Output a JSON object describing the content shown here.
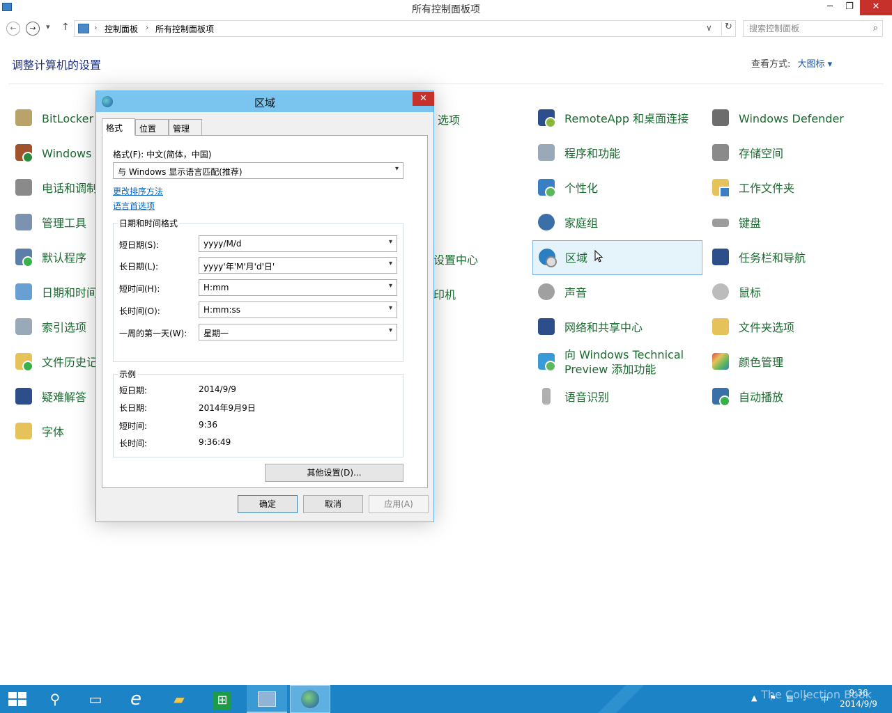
{
  "window": {
    "title": "所有控制面板项",
    "min": "─",
    "max": "❐",
    "close": "✕"
  },
  "nav": {
    "back": "←",
    "forward": "→",
    "recent": "▾",
    "up": "↑",
    "breadcrumbs": [
      "控制面板",
      "所有控制面板项"
    ],
    "separator": "›",
    "dropdown": "∨",
    "refresh": "↻",
    "search_placeholder": "搜索控制面板",
    "search_icon": "⌕"
  },
  "header": {
    "heading": "调整计算机的设置",
    "view_by_label": "查看方式:",
    "view_by_value": "大图标 ▾"
  },
  "items": {
    "col1": [
      "BitLocker",
      "Windows",
      "电话和调制",
      "管理工具",
      "默认程序",
      "日期和时间",
      "索引选项",
      "文件历史记",
      "疑难解答",
      "字体"
    ],
    "col2_partial": [
      "选项",
      "",
      "",
      "",
      "设置中心",
      "印机",
      "",
      "",
      "",
      ""
    ],
    "col3": [
      "RemoteApp 和桌面连接",
      "程序和功能",
      "个性化",
      "家庭组",
      "区域",
      "声音",
      "网络和共享中心",
      "向 Windows Technical Preview 添加功能",
      "语音识别",
      ""
    ],
    "col4": [
      "Windows Defender",
      "存储空间",
      "工作文件夹",
      "键盘",
      "任务栏和导航",
      "鼠标",
      "文件夹选项",
      "颜色管理",
      "自动播放",
      ""
    ]
  },
  "colors": {
    "item_label": "#1b6a30",
    "accent": "#1c83c6",
    "close_red": "#c7312c",
    "dialog_title": "#7ac5f0"
  },
  "dialog": {
    "title": "区域",
    "close": "✕",
    "tabs": [
      "格式",
      "位置",
      "管理"
    ],
    "format_label": "格式(F): 中文(简体，中国)",
    "format_value": "与 Windows 显示语言匹配(推荐)",
    "link_sort": "更改排序方法",
    "link_lang": "语言首选项",
    "datetime_group": "日期和时间格式",
    "rows": [
      {
        "label": "短日期(S):",
        "value": "yyyy/M/d"
      },
      {
        "label": "长日期(L):",
        "value": "yyyy'年'M'月'd'日'"
      },
      {
        "label": "短时间(H):",
        "value": "H:mm"
      },
      {
        "label": "长时间(O):",
        "value": "H:mm:ss"
      },
      {
        "label": "一周的第一天(W):",
        "value": "星期一"
      }
    ],
    "examples_group": "示例",
    "examples": [
      {
        "label": "短日期:",
        "value": "2014/9/9"
      },
      {
        "label": "长日期:",
        "value": "2014年9月9日"
      },
      {
        "label": "短时间:",
        "value": "9:36"
      },
      {
        "label": "长时间:",
        "value": "9:36:49"
      }
    ],
    "other_settings": "其他设置(D)...",
    "ok": "确定",
    "cancel": "取消",
    "apply": "应用(A)",
    "select_arrow": "▾"
  },
  "taskbar": {
    "search_icon": "⚲",
    "taskview_icon": "▭",
    "ie_icon": "e",
    "explorer_icon": "▰",
    "store_icon": "⊞",
    "tray_up": "▲",
    "tray_flag": "⚑",
    "tray_net": "▤",
    "tray_vol": "♪",
    "tray_ime": "中",
    "time": "9:36",
    "date": "2014/9/9",
    "watermark": "The Collection Book"
  }
}
